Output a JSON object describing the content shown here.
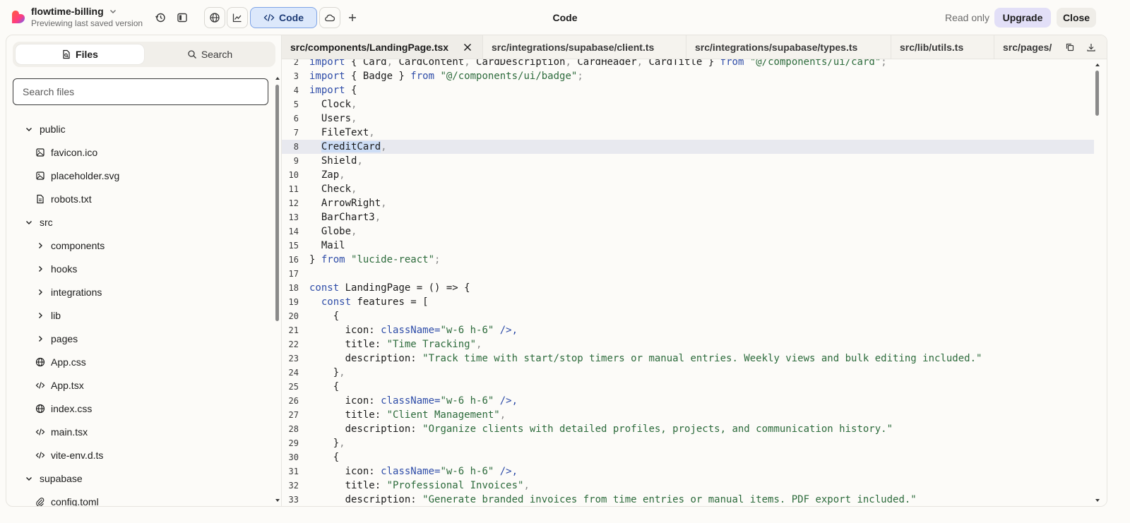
{
  "header": {
    "project_name": "flowtime-billing",
    "project_subtitle": "Previewing last saved version",
    "code_button": "Code",
    "center_title": "Code",
    "read_only": "Read only",
    "upgrade": "Upgrade",
    "close": "Close"
  },
  "sidebar": {
    "tab_files": "Files",
    "tab_search": "Search",
    "search_placeholder": "Search files",
    "tree": [
      {
        "label": "public",
        "kind": "folder-open",
        "depth": 0
      },
      {
        "label": "favicon.ico",
        "kind": "image",
        "depth": 1
      },
      {
        "label": "placeholder.svg",
        "kind": "image",
        "depth": 1
      },
      {
        "label": "robots.txt",
        "kind": "file",
        "depth": 1
      },
      {
        "label": "src",
        "kind": "folder-open",
        "depth": 0
      },
      {
        "label": "components",
        "kind": "folder-closed",
        "depth": 1
      },
      {
        "label": "hooks",
        "kind": "folder-closed",
        "depth": 1
      },
      {
        "label": "integrations",
        "kind": "folder-closed",
        "depth": 1
      },
      {
        "label": "lib",
        "kind": "folder-closed",
        "depth": 1
      },
      {
        "label": "pages",
        "kind": "folder-closed",
        "depth": 1
      },
      {
        "label": "App.css",
        "kind": "globe",
        "depth": 1
      },
      {
        "label": "App.tsx",
        "kind": "code",
        "depth": 1
      },
      {
        "label": "index.css",
        "kind": "globe",
        "depth": 1
      },
      {
        "label": "main.tsx",
        "kind": "code",
        "depth": 1
      },
      {
        "label": "vite-env.d.ts",
        "kind": "code",
        "depth": 1
      },
      {
        "label": "supabase",
        "kind": "folder-open",
        "depth": 0
      },
      {
        "label": "config.toml",
        "kind": "clip",
        "depth": 1
      }
    ]
  },
  "editor": {
    "tabs": [
      {
        "label": "src/components/LandingPage.tsx",
        "active": true
      },
      {
        "label": "src/integrations/supabase/client.ts",
        "active": false
      },
      {
        "label": "src/integrations/supabase/types.ts",
        "active": false
      },
      {
        "label": "src/lib/utils.ts",
        "active": false
      },
      {
        "label": "src/pages/",
        "active": false
      }
    ],
    "highlighted_line": 8,
    "lines": [
      {
        "n": "2",
        "html": "<span class='kw'>import</span> { Card<span class='punc'>,</span> CardContent<span class='punc'>,</span> CardDescription<span class='punc'>,</span> CardHeader<span class='punc'>,</span> CardTitle } <span class='kw'>from</span> <span class='str'>\"@/components/ui/card\"</span><span class='punc'>;</span>"
      },
      {
        "n": "3",
        "html": "<span class='kw'>import</span> { Badge } <span class='kw'>from</span> <span class='str'>\"@/components/ui/badge\"</span><span class='punc'>;</span>"
      },
      {
        "n": "4",
        "html": "<span class='kw'>import</span> {"
      },
      {
        "n": "5",
        "html": "  Clock<span class='punc'>,</span>"
      },
      {
        "n": "6",
        "html": "  Users<span class='punc'>,</span>"
      },
      {
        "n": "7",
        "html": "  FileText<span class='punc'>,</span>"
      },
      {
        "n": "8",
        "html": "  <span class='sel'>CreditCard</span><span class='punc'>,</span>"
      },
      {
        "n": "9",
        "html": "  Shield<span class='punc'>,</span>"
      },
      {
        "n": "10",
        "html": "  Zap<span class='punc'>,</span>"
      },
      {
        "n": "11",
        "html": "  Check<span class='punc'>,</span>"
      },
      {
        "n": "12",
        "html": "  ArrowRight<span class='punc'>,</span>"
      },
      {
        "n": "13",
        "html": "  BarChart3<span class='punc'>,</span>"
      },
      {
        "n": "14",
        "html": "  Globe<span class='punc'>,</span>"
      },
      {
        "n": "15",
        "html": "  Mail"
      },
      {
        "n": "16",
        "html": "} <span class='kw'>from</span> <span class='str'>\"lucide-react\"</span><span class='punc'>;</span>"
      },
      {
        "n": "17",
        "html": ""
      },
      {
        "n": "18",
        "html": "<span class='kw'>const</span> LandingPage = () => {"
      },
      {
        "n": "19",
        "html": "  <span class='kw'>const</span> features = ["
      },
      {
        "n": "20",
        "html": "    {"
      },
      {
        "n": "21",
        "html": "      icon: <Clock <span class='prop'>className</span>=<span class='str'>\"w-6 h-6\"</span> />,"
      },
      {
        "n": "22",
        "html": "      title: <span class='str'>\"Time Tracking\"</span><span class='punc'>,</span>"
      },
      {
        "n": "23",
        "html": "      description: <span class='str'>\"Track time with start/stop timers or manual entries. Weekly views and bulk editing included.\"</span>"
      },
      {
        "n": "24",
        "html": "    }<span class='punc'>,</span>"
      },
      {
        "n": "25",
        "html": "    {"
      },
      {
        "n": "26",
        "html": "      icon: <Users <span class='prop'>className</span>=<span class='str'>\"w-6 h-6\"</span> />,"
      },
      {
        "n": "27",
        "html": "      title: <span class='str'>\"Client Management\"</span><span class='punc'>,</span>"
      },
      {
        "n": "28",
        "html": "      description: <span class='str'>\"Organize clients with detailed profiles, projects, and communication history.\"</span>"
      },
      {
        "n": "29",
        "html": "    }<span class='punc'>,</span>"
      },
      {
        "n": "30",
        "html": "    {"
      },
      {
        "n": "31",
        "html": "      icon: <FileText <span class='prop'>className</span>=<span class='str'>\"w-6 h-6\"</span> />,"
      },
      {
        "n": "32",
        "html": "      title: <span class='str'>\"Professional Invoices\"</span><span class='punc'>,</span>"
      },
      {
        "n": "33",
        "html": "      description: <span class='str'>\"Generate branded invoices from time entries or manual items. PDF export included.\"</span>"
      }
    ]
  },
  "colors": {
    "accent_blue": "#dce8fb",
    "upgrade_bg": "#e2dff7",
    "keyword": "#2f4da8",
    "string": "#2d6b3c"
  }
}
